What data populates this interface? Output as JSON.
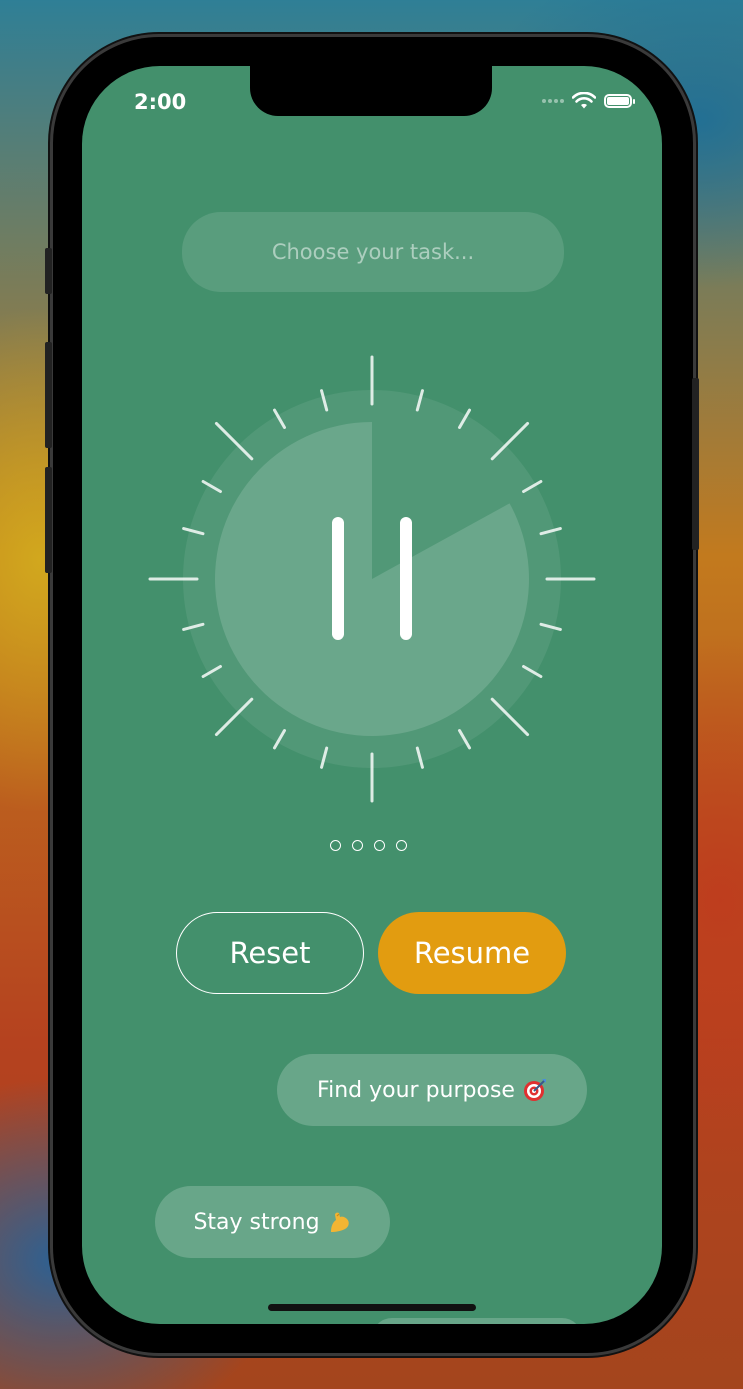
{
  "status": {
    "time": "2:00"
  },
  "task": {
    "placeholder": "Choose your task..."
  },
  "timer": {
    "remaining_fraction": 0.83,
    "state": "paused"
  },
  "pager": {
    "count": 4
  },
  "controls": {
    "reset_label": "Reset",
    "resume_label": "Resume"
  },
  "messages": [
    {
      "text": "Find your purpose",
      "icon": "target-icon"
    },
    {
      "text": "Stay strong",
      "icon": "flexed-biceps-icon"
    }
  ],
  "colors": {
    "background": "#43906c",
    "accent": "#e29c10",
    "text": "#ffffff"
  }
}
